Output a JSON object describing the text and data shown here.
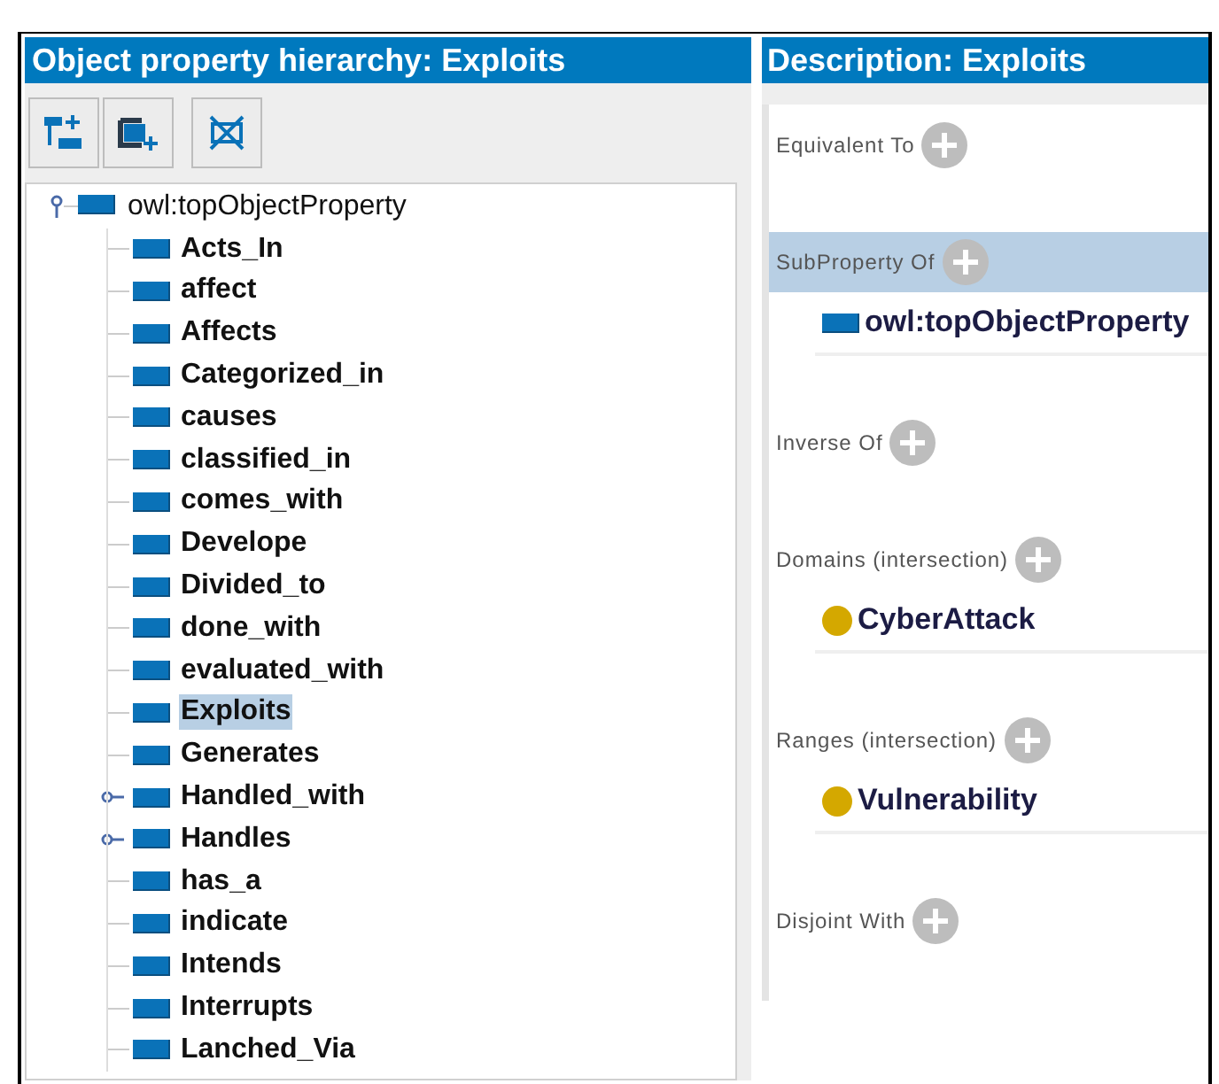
{
  "hierarchy": {
    "title": "Object property hierarchy: Exploits",
    "toolbar": [
      {
        "kind": "add-child"
      },
      {
        "kind": "add-sibling"
      },
      {
        "kind": "delete"
      }
    ],
    "root": {
      "label": "owl:topObjectProperty",
      "expanded": true,
      "selected": false,
      "children": [
        {
          "label": "Acts_In",
          "selected": false,
          "has_children": false
        },
        {
          "label": "affect",
          "selected": false,
          "has_children": false
        },
        {
          "label": "Affects",
          "selected": false,
          "has_children": false
        },
        {
          "label": "Categorized_in",
          "selected": false,
          "has_children": false
        },
        {
          "label": "causes",
          "selected": false,
          "has_children": false
        },
        {
          "label": "classified_in",
          "selected": false,
          "has_children": false
        },
        {
          "label": "comes_with",
          "selected": false,
          "has_children": false
        },
        {
          "label": "Develope",
          "selected": false,
          "has_children": false
        },
        {
          "label": "Divided_to",
          "selected": false,
          "has_children": false
        },
        {
          "label": "done_with",
          "selected": false,
          "has_children": false
        },
        {
          "label": "evaluated_with",
          "selected": false,
          "has_children": false
        },
        {
          "label": "Exploits",
          "selected": true,
          "has_children": false
        },
        {
          "label": "Generates",
          "selected": false,
          "has_children": false
        },
        {
          "label": "Handled_with",
          "selected": false,
          "has_children": true
        },
        {
          "label": "Handles",
          "selected": false,
          "has_children": true
        },
        {
          "label": "has_a",
          "selected": false,
          "has_children": false
        },
        {
          "label": "indicate",
          "selected": false,
          "has_children": false
        },
        {
          "label": "Intends",
          "selected": false,
          "has_children": false
        },
        {
          "label": "Interrupts",
          "selected": false,
          "has_children": false
        },
        {
          "label": "Lanched_Via",
          "selected": false,
          "has_children": false
        }
      ]
    }
  },
  "description": {
    "title": "Description: Exploits",
    "sections": [
      {
        "heading": "Equivalent To",
        "selected": false
      },
      {
        "heading": "SubProperty Of",
        "selected": true,
        "items": [
          {
            "label": "owl:topObjectProperty",
            "kind": "property"
          }
        ]
      },
      {
        "heading": "Inverse Of",
        "selected": false
      },
      {
        "heading": "Domains (intersection)",
        "selected": false,
        "items": [
          {
            "label": "CyberAttack",
            "kind": "class",
            "color": "#d4a800"
          }
        ]
      },
      {
        "heading": "Ranges (intersection)",
        "selected": false,
        "items": [
          {
            "label": "Vulnerability",
            "kind": "class",
            "color": "#d4a800"
          }
        ]
      },
      {
        "heading": "Disjoint With",
        "selected": false
      }
    ]
  }
}
